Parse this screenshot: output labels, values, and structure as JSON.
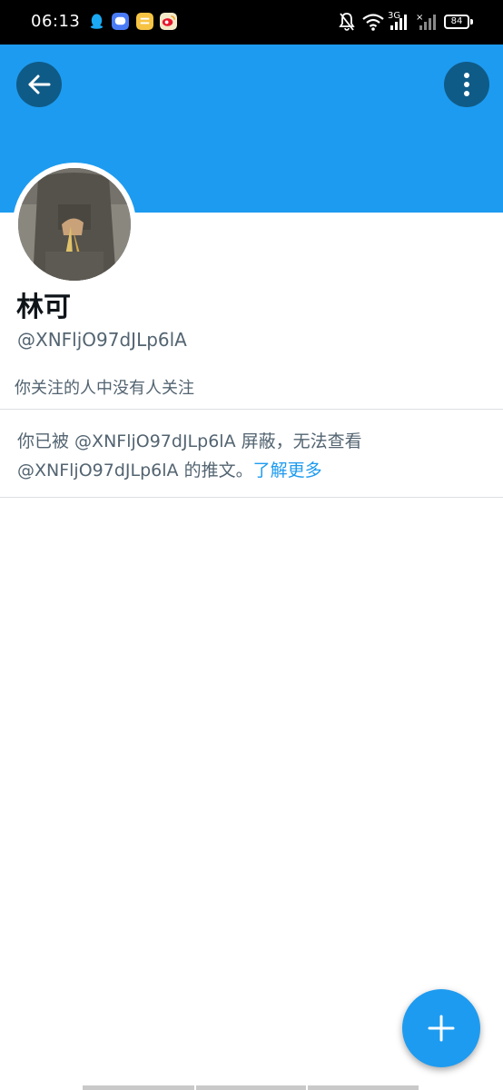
{
  "status_bar": {
    "time": "06:13",
    "network": "3G",
    "battery": "84",
    "app_icons": [
      "qq-icon",
      "chat-bubble-icon",
      "notes-icon",
      "weibo-icon"
    ]
  },
  "header": {
    "banner_color": "#1d9bf0",
    "back_icon": "arrow-left-icon",
    "more_icon": "more-vertical-icon"
  },
  "profile": {
    "display_name": "林可",
    "handle": "@XNFljO97dJLp6lA",
    "followers_note": "你关注的人中没有人关注"
  },
  "blocked_notice": {
    "part1": "你已被 ",
    "handle": "@XNFljO97dJLp6lA",
    "part2": " 屏蔽，无法查看",
    "handle2": "@XNFljO97dJLp6lA",
    "part3": " 的推文。",
    "learn_more": "了解更多"
  },
  "fab": {
    "icon": "plus-icon",
    "color": "#1d9bf0"
  }
}
